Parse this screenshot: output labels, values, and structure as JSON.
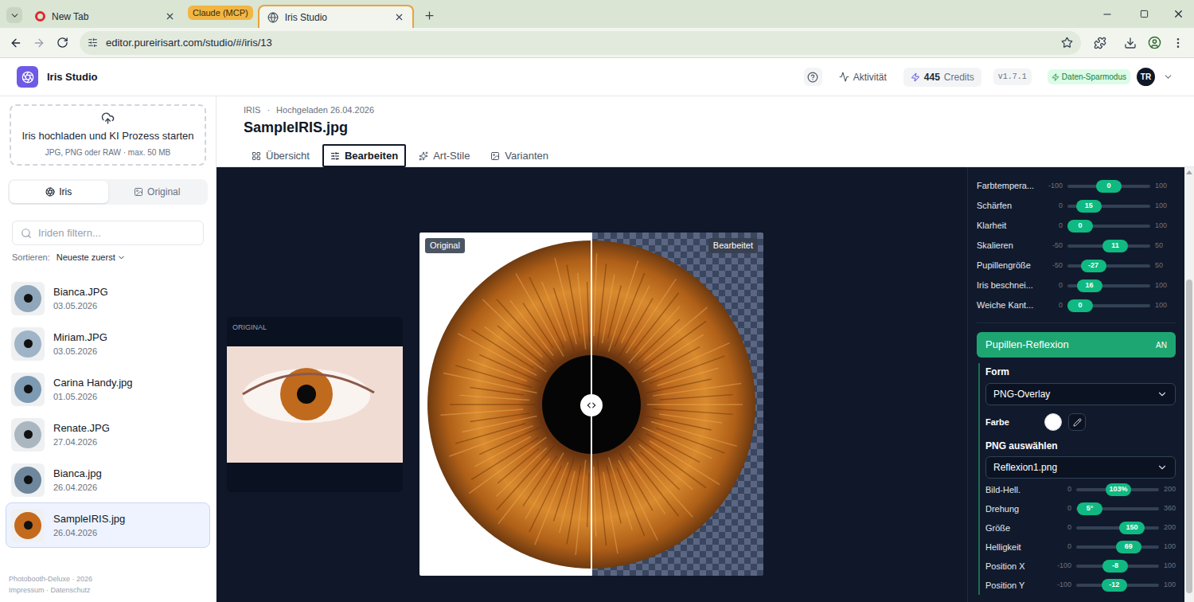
{
  "browser": {
    "tabs": [
      {
        "title": "New Tab",
        "selected": false,
        "in_group": false,
        "kind": "newtab"
      },
      {
        "title": "Iris Studio",
        "selected": true,
        "in_group": true,
        "kind": "site"
      }
    ],
    "tab_group": "Claude (MCP)",
    "url": "editor.pureirisart.com/studio/#/iris/13"
  },
  "app": {
    "name": "Iris Studio",
    "header": {
      "activity": "Aktivität",
      "credits_count": "445",
      "credits_label": "Credits",
      "version": "v1.7.1",
      "data_saver": "Daten-Sparmodus",
      "avatar": "TR"
    }
  },
  "sidebar": {
    "upload": {
      "title": "Iris hochladen und KI Prozess starten",
      "hint": "JPG, PNG oder RAW · max. 50 MB"
    },
    "view_tabs": [
      {
        "label": "Iris",
        "selected": true
      },
      {
        "label": "Original",
        "selected": false
      }
    ],
    "search": {
      "placeholder": "Iriden filtern..."
    },
    "sort": {
      "label": "Sortieren:",
      "value": "Neueste zuerst"
    },
    "items": [
      {
        "name": "Bianca.JPG",
        "date": "03.05.2026",
        "selected": false,
        "color": "#8fa6bb"
      },
      {
        "name": "Miriam.JPG",
        "date": "03.05.2026",
        "selected": false,
        "color": "#9fb4c6"
      },
      {
        "name": "Carina Handy.jpg",
        "date": "01.05.2026",
        "selected": false,
        "color": "#7d9ab3"
      },
      {
        "name": "Renate.JPG",
        "date": "27.04.2026",
        "selected": false,
        "color": "#aab7c1"
      },
      {
        "name": "Bianca.jpg",
        "date": "26.04.2026",
        "selected": false,
        "color": "#6e879c"
      },
      {
        "name": "SampleIRIS.jpg",
        "date": "26.04.2026",
        "selected": true,
        "color": "#c46a1c"
      }
    ],
    "footer": {
      "brand": "Photobooth-Deluxe · 2026",
      "links": "Impressum · Datenschutz"
    }
  },
  "main": {
    "breadcrumb": {
      "section": "IRIS",
      "separator": "·",
      "uploaded": "Hochgeladen 26.04.2026"
    },
    "title": "SampleIRIS.jpg",
    "tabs": [
      {
        "label": "Übersicht",
        "selected": false
      },
      {
        "label": "Bearbeiten",
        "selected": true
      },
      {
        "label": "Art-Stile",
        "selected": false
      },
      {
        "label": "Varianten",
        "selected": false
      }
    ]
  },
  "canvas": {
    "original_card_label": "ORIGINAL",
    "compare": {
      "left_label": "Original",
      "right_label": "Bearbeitet",
      "split": 0.5
    }
  },
  "panel": {
    "sliders": [
      {
        "label": "Farbtempera...",
        "min": "-100",
        "value": "0",
        "max": "100",
        "level": 0.5
      },
      {
        "label": "Schärfen",
        "min": "0",
        "value": "15",
        "max": "100",
        "level": 0.15
      },
      {
        "label": "Klarheit",
        "min": "0",
        "value": "0",
        "max": "100",
        "level": 0
      },
      {
        "label": "Skalieren",
        "min": "-50",
        "value": "11",
        "max": "50",
        "level": 0.61
      },
      {
        "label": "Pupillengröße",
        "min": "-50",
        "value": "-27",
        "max": "50",
        "level": 0.23
      },
      {
        "label": "Iris beschnei...",
        "min": "0",
        "value": "16",
        "max": "100",
        "level": 0.16
      },
      {
        "label": "Weiche Kant...",
        "min": "0",
        "value": "0",
        "max": "100",
        "level": 0
      }
    ],
    "reflection": {
      "label": "Pupillen-Reflexion",
      "state": "AN",
      "on": true,
      "form_label": "Form",
      "form_value": "PNG-Overlay",
      "color_label": "Farbe",
      "color": "#ffffff",
      "png_label": "PNG auswählen",
      "png_value": "Reflexion1.png",
      "sliders": [
        {
          "label": "Bild-Hell.",
          "min": "0",
          "value": "103%",
          "max": "200",
          "level": 0.515
        },
        {
          "label": "Drehung",
          "min": "0",
          "value": "5°",
          "max": "360",
          "level": 0.014
        },
        {
          "label": "Größe",
          "min": "0",
          "value": "150",
          "max": "200",
          "level": 0.75
        },
        {
          "label": "Helligkeit",
          "min": "0",
          "value": "69",
          "max": "100",
          "level": 0.69
        },
        {
          "label": "Position X",
          "min": "-100",
          "value": "-8",
          "max": "100",
          "level": 0.46
        },
        {
          "label": "Position Y",
          "min": "-100",
          "value": "-12",
          "max": "100",
          "level": 0.44
        }
      ]
    }
  }
}
